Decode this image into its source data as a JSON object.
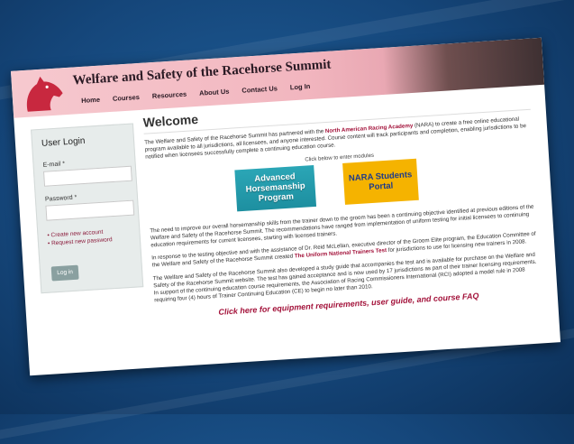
{
  "header": {
    "title": "Welfare and Safety of the Racehorse Summit",
    "nav": [
      "Home",
      "Courses",
      "Resources",
      "About Us",
      "Contact Us",
      "Log In"
    ]
  },
  "login": {
    "title": "User Login",
    "email_label": "E-mail *",
    "password_label": "Password *",
    "create_account": "Create new account",
    "request_password": "Request new password",
    "login_button": "Log in"
  },
  "main": {
    "heading": "Welcome",
    "intro_before": "The Welfare and Safety of the Racehorse Summit has partnered with the ",
    "intro_link": "North American Racing Academy",
    "intro_after": " (NARA) to create a free online educational program available to all jurisdictions, all licensees, and anyone interested. Course content will track participants and completion, enabling jurisdictions to be notified when licensees successfully complete a continuing education course.",
    "click_below": "Click below to enter modules",
    "module_advanced": "Advanced Horsemanship Program",
    "module_nara": "NARA Students Portal",
    "para1": "The need to improve our overall horsemanship skills from the trainer down to the groom has been a continuing objective identified at previous editions of the Welfare and Safety of the Racehorse Summit. The recommendations have ranged from implementation of uniform testing for initial licensees to continuing education requirements for current licensees, starting with licensed trainers.",
    "para2_before": "In response to the testing objective and with the assistance of Dr. Reid McLellan, executive director of the Groom Elite program, the Education Committee of the Welfare and Safety of the Racehorse Summit created ",
    "para2_link": "The Uniform National Trainers Test",
    "para2_after": " for jurisdictions to use for licensing new trainers in 2008.",
    "para3": "The Welfare and Safety of the Racehorse Summit also developed a study guide that accompanies the test and is available for purchase on the Welfare and Safety of the Racehorse Summit website. The test has gained acceptance and is now used by 17 jurisdictions as part of their trainer licensing requirements. In support of the continuing education course requirements, the Association of Racing Commissioners International (RCI) adopted a model rule in 2008 requiring four (4) hours of Trainer Continuing Education (CE) to begin no later than 2010.",
    "faq_link": "Click here for equipment requirements, user guide, and course FAQ"
  },
  "colors": {
    "accent": "#a3123a",
    "header_pink": "#f2b6bf",
    "background_blue": "#15467a",
    "advanced_button": "#1d8fa0",
    "nara_button": "#f5b300"
  }
}
